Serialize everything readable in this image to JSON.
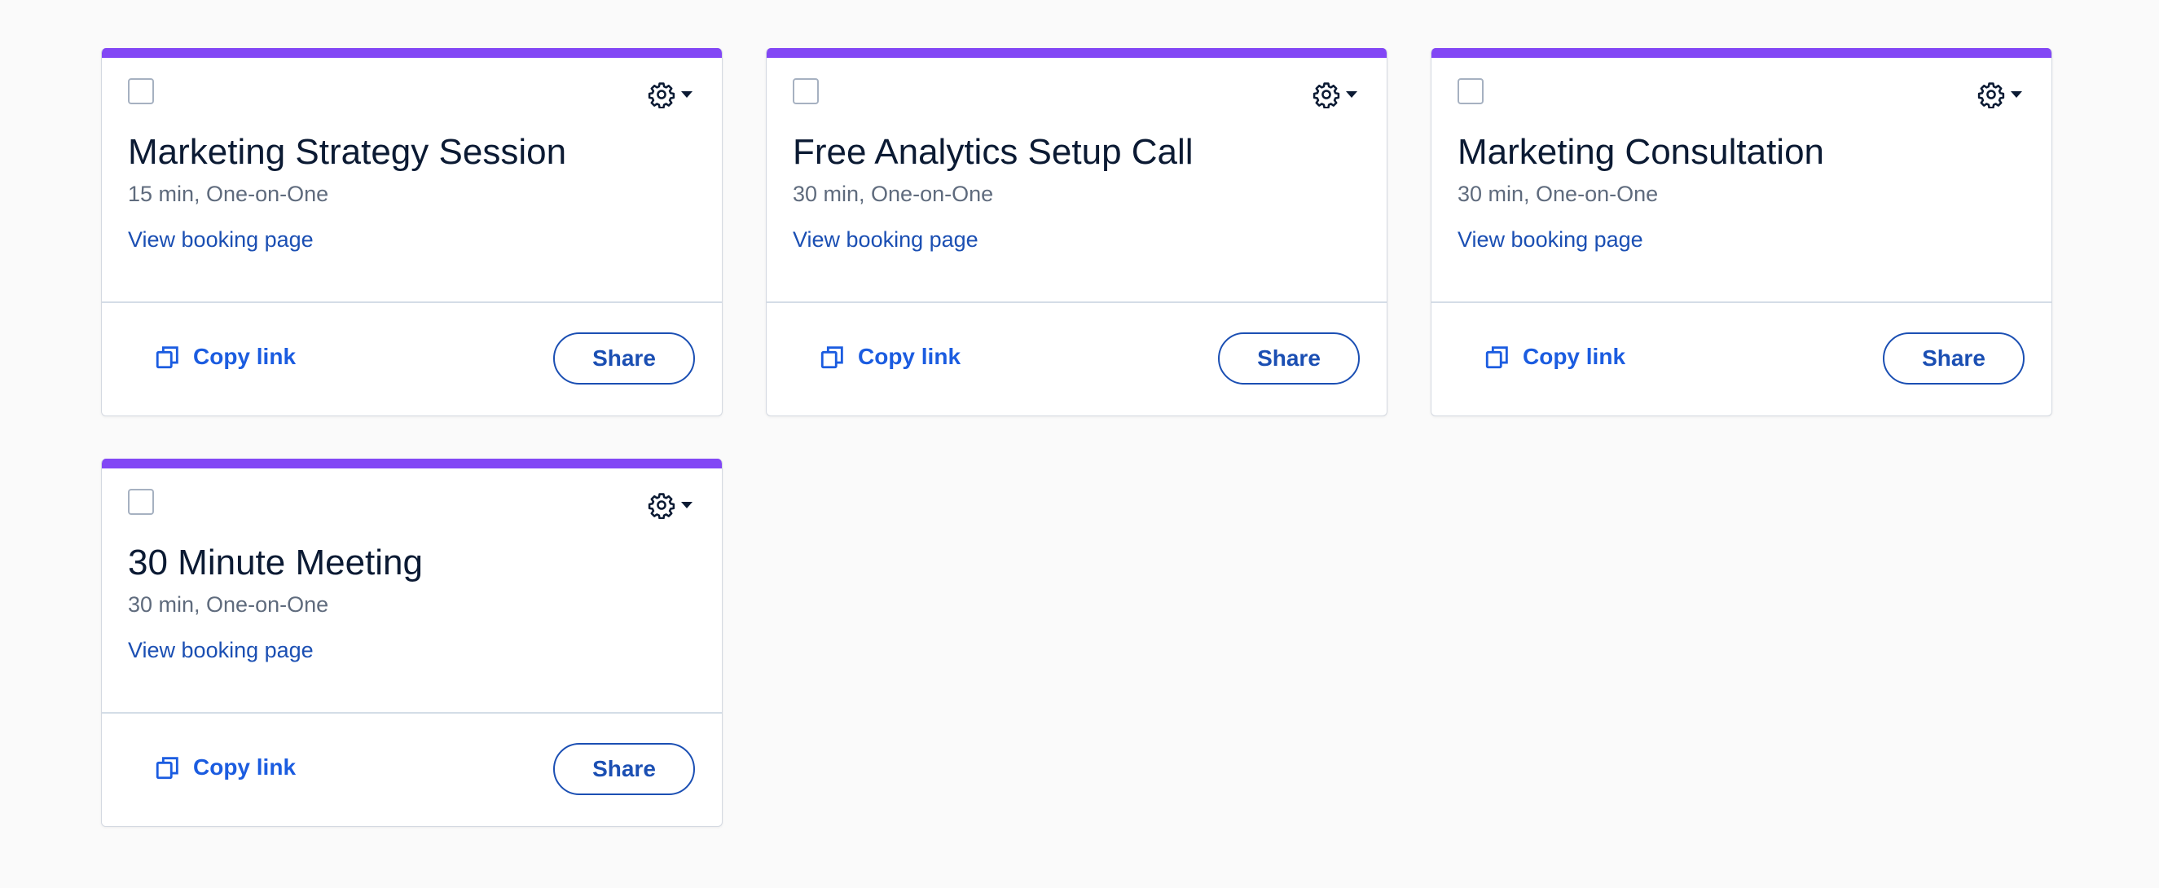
{
  "colors": {
    "accent_bar": "#8247f5",
    "link": "#1b4fb3",
    "copy_link": "#1b5ce0",
    "title": "#0b1a33",
    "subtitle": "#5f6b7d",
    "background": "#fafafa"
  },
  "icons": {
    "settings": "gear-icon",
    "settings_caret": "caret-down-icon",
    "copy": "copy-icon"
  },
  "cards": [
    {
      "title": "Marketing Strategy Session",
      "subtitle": "15 min, One-on-One",
      "view_link": "View booking page",
      "copy_label": "Copy link",
      "share_label": "Share"
    },
    {
      "title": "Free Analytics Setup Call",
      "subtitle": "30 min, One-on-One",
      "view_link": "View booking page",
      "copy_label": "Copy link",
      "share_label": "Share"
    },
    {
      "title": "Marketing Consultation",
      "subtitle": "30 min, One-on-One",
      "view_link": "View booking page",
      "copy_label": "Copy link",
      "share_label": "Share"
    },
    {
      "title": "30 Minute Meeting",
      "subtitle": "30 min, One-on-One",
      "view_link": "View booking page",
      "copy_label": "Copy link",
      "share_label": "Share"
    }
  ]
}
